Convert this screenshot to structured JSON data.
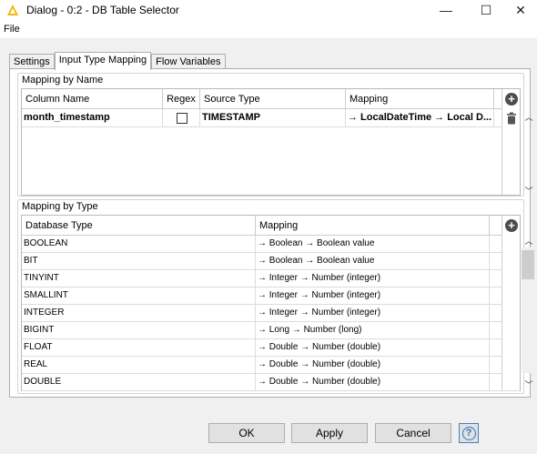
{
  "window": {
    "title": "Dialog - 0:2 - DB Table Selector",
    "minimize_glyph": "—",
    "maximize_glyph": "☐",
    "close_glyph": "✕"
  },
  "menu": {
    "file_label": "File"
  },
  "tabs": [
    {
      "label": "Settings",
      "active": false
    },
    {
      "label": "Input Type Mapping",
      "active": true
    },
    {
      "label": "Flow Variables",
      "active": false
    }
  ],
  "mapping_by_name": {
    "group_label": "Mapping by Name",
    "headers": {
      "column_name": "Column Name",
      "regex": "Regex",
      "source_type": "Source Type",
      "mapping": "Mapping"
    },
    "rows": [
      {
        "column_name": "month_timestamp",
        "regex": false,
        "source_type": "TIMESTAMP",
        "mapping": "→ LocalDateTime → Local D..."
      }
    ]
  },
  "mapping_by_type": {
    "group_label": "Mapping by Type",
    "headers": {
      "database_type": "Database Type",
      "mapping": "Mapping"
    },
    "rows": [
      {
        "database_type": "BOOLEAN",
        "mapping": "→ Boolean → Boolean value"
      },
      {
        "database_type": "BIT",
        "mapping": "→ Boolean → Boolean value"
      },
      {
        "database_type": "TINYINT",
        "mapping": "→ Integer → Number (integer)"
      },
      {
        "database_type": "SMALLINT",
        "mapping": "→ Integer → Number (integer)"
      },
      {
        "database_type": "INTEGER",
        "mapping": "→ Integer → Number (integer)"
      },
      {
        "database_type": "BIGINT",
        "mapping": "→ Long → Number (long)"
      },
      {
        "database_type": "FLOAT",
        "mapping": "→ Double → Number (double)"
      },
      {
        "database_type": "REAL",
        "mapping": "→ Double → Number (double)"
      },
      {
        "database_type": "DOUBLE",
        "mapping": "→ Double → Number (double)"
      }
    ]
  },
  "buttons": {
    "ok": "OK",
    "apply": "Apply",
    "cancel": "Cancel",
    "help": "?"
  },
  "colors": {
    "accent": "#2f72c4",
    "logo": "#f2b705",
    "icon_dark": "#4d4d4d"
  }
}
